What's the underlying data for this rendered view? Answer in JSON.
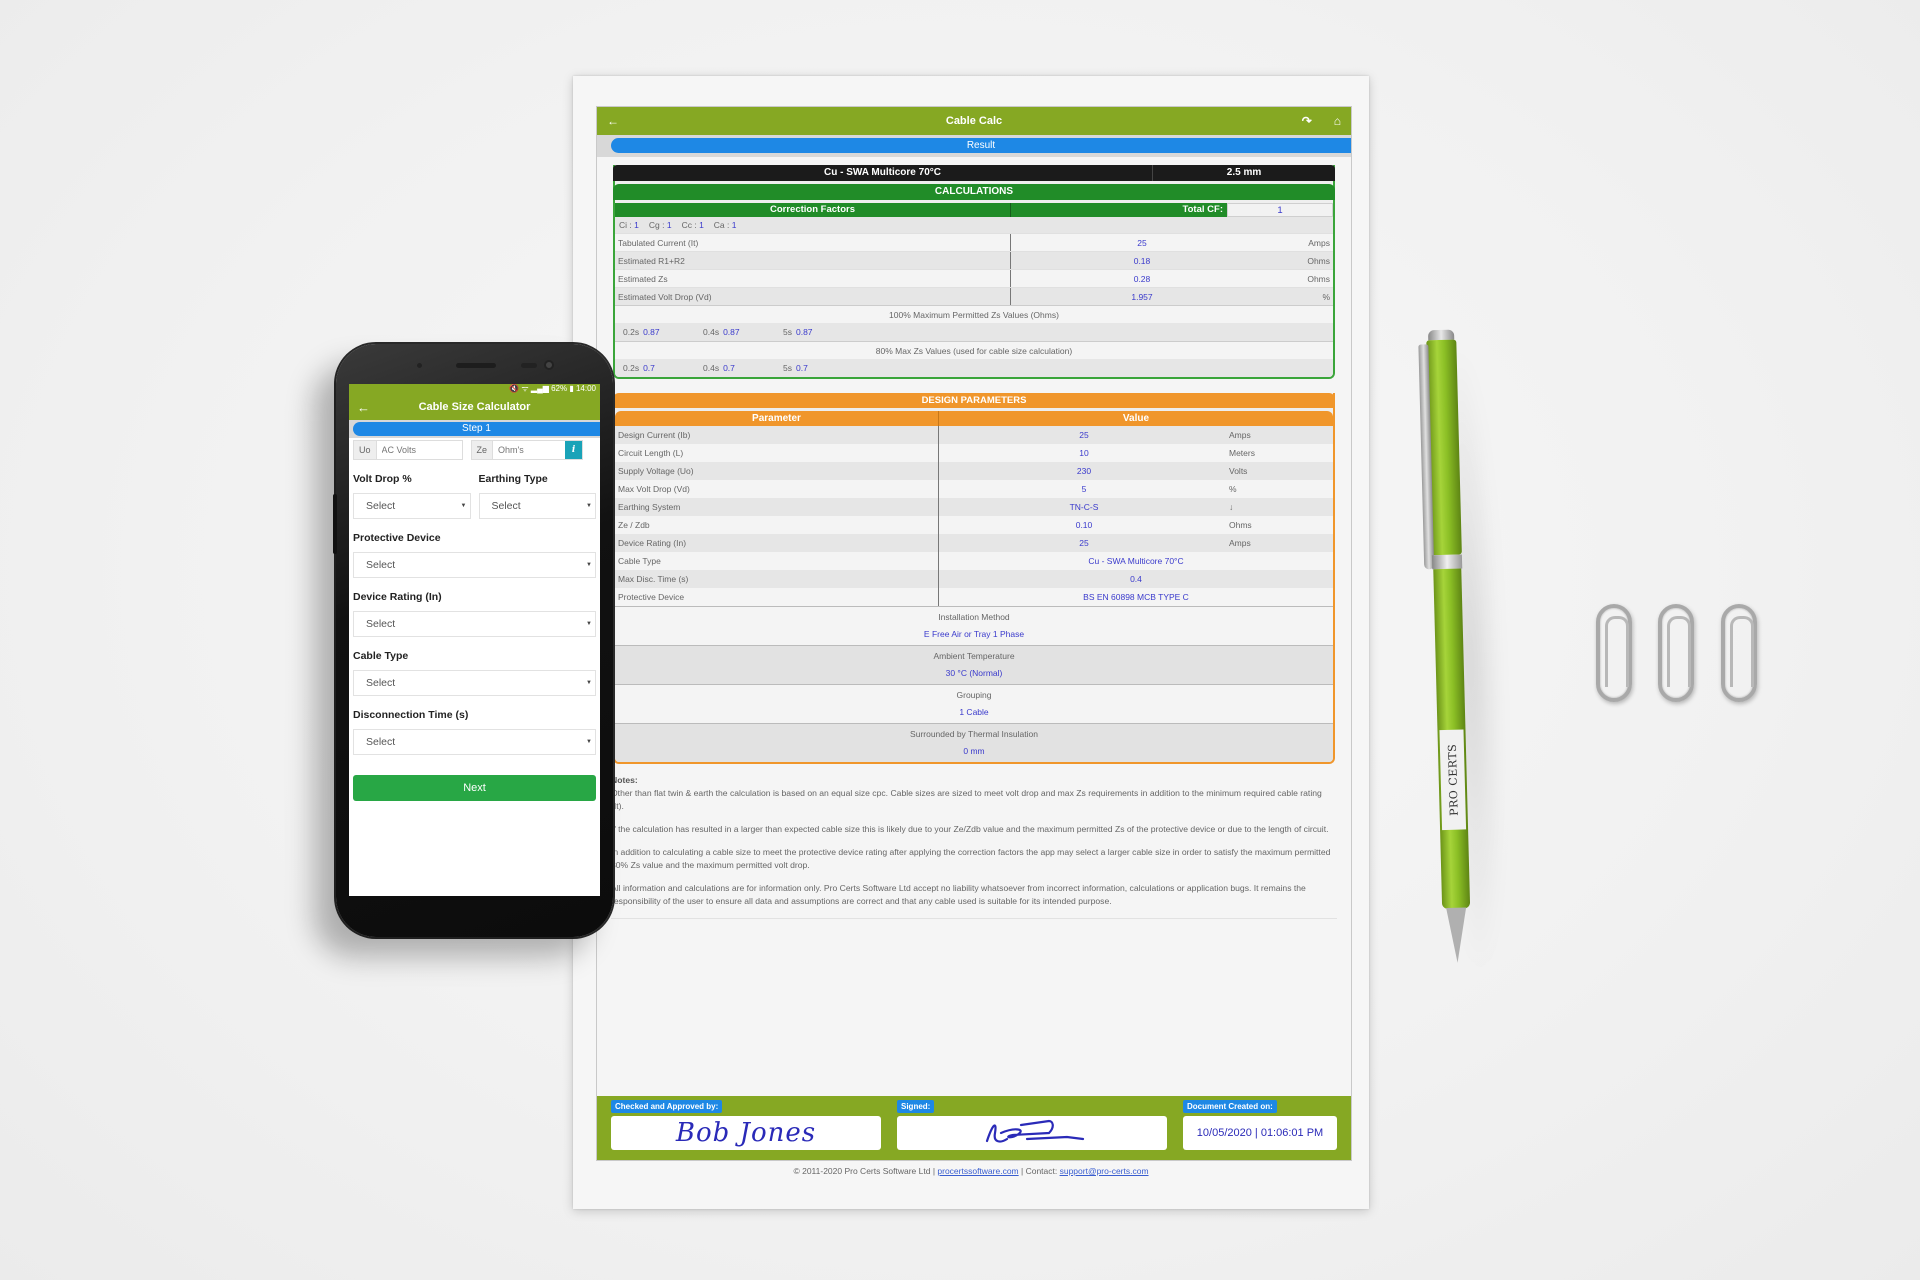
{
  "document": {
    "app_title": "Cable Calc",
    "icons": {
      "back": "back-arrow-icon",
      "undo": "undo-icon",
      "home": "home-icon"
    },
    "step_label": "Result",
    "cable": {
      "type": "Cu - SWA Multicore 70°C",
      "size": "2.5 mm"
    },
    "calculations": {
      "title": "CALCULATIONS",
      "correction_factors_label": "Correction Factors",
      "total_cf_label": "Total CF:",
      "total_cf_value": "1",
      "factors": [
        {
          "label": "Ci :",
          "value": "1"
        },
        {
          "label": "Cg :",
          "value": "1"
        },
        {
          "label": "Cc :",
          "value": "1"
        },
        {
          "label": "Ca :",
          "value": "1"
        }
      ],
      "rows": [
        {
          "label": "Tabulated Current  (It)",
          "value": "25",
          "unit": "Amps"
        },
        {
          "label": "Estimated R1+R2",
          "value": "0.18",
          "unit": "Ohms"
        },
        {
          "label": "Estimated Zs",
          "value": "0.28",
          "unit": "Ohms"
        },
        {
          "label": "Estimated Volt Drop  (Vd)",
          "value": "1.957",
          "unit": "%"
        }
      ],
      "zs100_title": "100% Maximum Permitted Zs Values (Ohms)",
      "zs100": [
        {
          "label": "0.2s",
          "value": "0.87"
        },
        {
          "label": "0.4s",
          "value": "0.87"
        },
        {
          "label": "5s",
          "value": "0.87"
        }
      ],
      "zs80_title": "80% Max Zs Values (used for cable size calculation)",
      "zs80": [
        {
          "label": "0.2s",
          "value": "0.7"
        },
        {
          "label": "0.4s",
          "value": "0.7"
        },
        {
          "label": "5s",
          "value": "0.7"
        }
      ]
    },
    "design": {
      "title": "DESIGN PARAMETERS",
      "col_parameter": "Parameter",
      "col_value": "Value",
      "rows": [
        {
          "label": "Design Current  (Ib)",
          "value": "25",
          "unit": "Amps"
        },
        {
          "label": "Circuit Length    (L)",
          "value": "10",
          "unit": "Meters"
        },
        {
          "label": "Supply Voltage  (Uo)",
          "value": "230",
          "unit": "Volts"
        },
        {
          "label": "Max Volt Drop   (Vd)",
          "value": "5",
          "unit": "%"
        },
        {
          "label": "Earthing System",
          "value": "TN-C-S",
          "unit": "↓"
        },
        {
          "label": "Ze / Zdb",
          "value": "0.10",
          "unit": "Ohms"
        },
        {
          "label": "Device Rating    (In)",
          "value": "25",
          "unit": "Amps"
        }
      ],
      "wide_rows": [
        {
          "label": "Cable Type",
          "value": "Cu - SWA Multicore 70°C"
        },
        {
          "label": "Max Disc. Time (s)",
          "value": "0.4"
        },
        {
          "label": "Protective Device",
          "value": "BS EN 60898 MCB TYPE C"
        }
      ],
      "blocks": [
        {
          "title": "Installation Method",
          "value": "E Free Air or Tray 1 Phase"
        },
        {
          "title": "Ambient Temperature",
          "value": "30 °C (Normal)"
        },
        {
          "title": "Grouping",
          "value": "1 Cable"
        },
        {
          "title": "Surrounded by Thermal Insulation",
          "value": "0 mm"
        }
      ]
    },
    "notes": {
      "title": "Notes:",
      "paragraphs": [
        "Other than flat twin & earth the calculation is based on an equal size cpc. Cable sizes are sized to meet volt drop and max Zs requirements in addition to the minimum required cable rating (It).",
        "If the calculation has resulted in a larger than expected cable size this is likely due to your Ze/Zdb value and the maximum permitted Zs of the protective device or due to the length of circuit.",
        "In addition to calculating a cable size to meet the protective device rating after applying the correction factors the app may select a larger cable size in order to satisfy the maximum permitted 80% Zs value and the maximum permitted volt drop.",
        "All information and calculations are for information only. Pro Certs Software Ltd accept no liability whatsoever from incorrect information, calculations or application bugs. It remains the responsibility of the user to ensure all data and assumptions are correct and that any cable used is suitable for its intended purpose."
      ]
    },
    "signoff": {
      "approved_label": "Checked and Approved by:",
      "approved_name": "Bob Jones",
      "signed_label": "Signed:",
      "created_label": "Document Created on:",
      "created_value": "10/05/2020 | 01:06:01 PM"
    },
    "footer": {
      "copyright": "© 2011-2020 Pro Certs Software Ltd | ",
      "website": "procertssoftware.com",
      "contact_label": " | Contact: ",
      "email": "support@pro-certs.com"
    }
  },
  "phone": {
    "status": "🔇 ᯤ ▂▄▆ 62% ▮ 14:00",
    "title": "Cable Size Calculator",
    "step_label": "Step 1",
    "uo_addon": "Uo",
    "uo_placeholder": "AC Volts",
    "ze_addon": "Ze",
    "ze_placeholder": "Ohm's",
    "info_icon": "i",
    "fields": {
      "volt_drop": {
        "label": "Volt Drop %",
        "value": "Select"
      },
      "earthing_type": {
        "label": "Earthing Type",
        "value": "Select"
      },
      "protective_device": {
        "label": "Protective Device",
        "value": "Select"
      },
      "device_rating": {
        "label": "Device Rating (In)",
        "value": "Select"
      },
      "cable_type": {
        "label": "Cable Type",
        "value": "Select"
      },
      "disconnection_time": {
        "label": "Disconnection Time (s)",
        "value": "Select"
      }
    },
    "next_label": "Next"
  },
  "pen": {
    "brand": "PRO CERTS"
  },
  "colors": {
    "brand_green": "#86a823",
    "result_blue": "#1e88e5",
    "calc_green": "#218c28",
    "design_orange": "#f0962b",
    "value_blue": "#3a3acc",
    "next_green": "#28a745"
  }
}
